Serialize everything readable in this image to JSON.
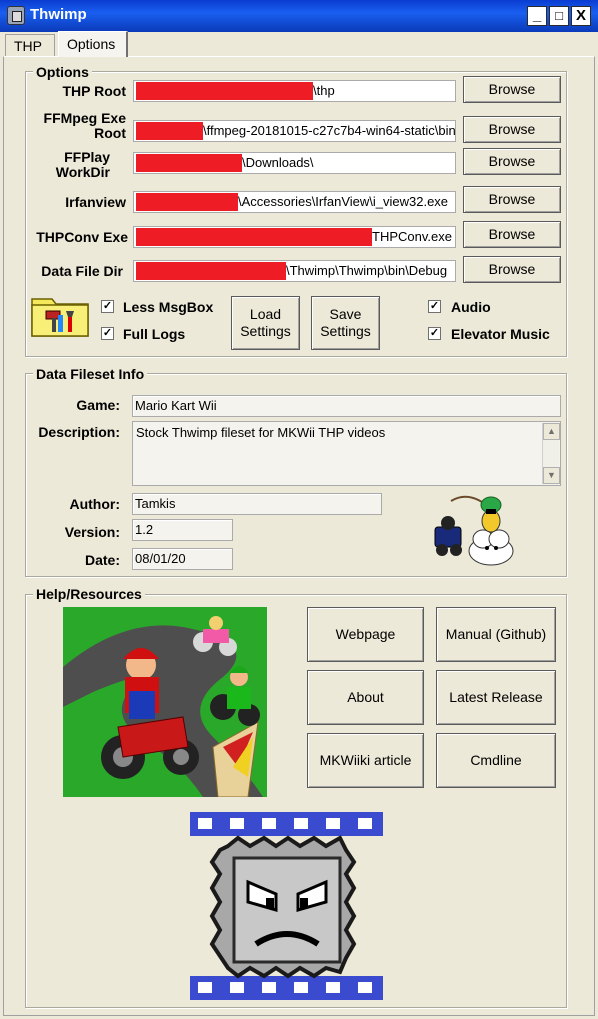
{
  "window": {
    "title": "Thwimp",
    "minimize": "_",
    "maximize": "□",
    "close": "X"
  },
  "tabs": [
    "THP",
    "Options"
  ],
  "options_group": {
    "legend": "Options",
    "rows": [
      {
        "label": "THP Root",
        "path": "\\thp",
        "browse": "Browse"
      },
      {
        "label": "FFMpeg Exe Root",
        "path": "\\ffmpeg-20181015-c27c7b4-win64-static\\bin",
        "browse": "Browse"
      },
      {
        "label": "FFPlay WorkDir",
        "path": "\\Downloads\\",
        "browse": "Browse"
      },
      {
        "label": "Irfanview",
        "path": "\\Accessories\\IrfanView\\i_view32.exe",
        "browse": "Browse"
      },
      {
        "label": "THPConv Exe",
        "path": "THPConv.exe",
        "browse": "Browse"
      },
      {
        "label": "Data File Dir",
        "path": "\\Thwimp\\Thwimp\\bin\\Debug",
        "browse": "Browse"
      }
    ],
    "less_msgbox": "Less MsgBox",
    "full_logs": "Full Logs",
    "load_settings": [
      "Load",
      "Settings"
    ],
    "save_settings": [
      "Save",
      "Settings"
    ],
    "audio": "Audio",
    "elevator_music": "Elevator Music"
  },
  "fileset_group": {
    "legend": "Data Fileset Info",
    "game_label": "Game:",
    "game_value": "Mario Kart Wii",
    "description_label": "Description:",
    "description_value": "Stock Thwimp fileset for MKWii THP videos",
    "author_label": "Author:",
    "author_value": "Tamkis",
    "version_label": "Version:",
    "version_value": "1.2",
    "date_label": "Date:",
    "date_value": "08/01/20"
  },
  "help_group": {
    "legend": "Help/Resources",
    "buttons": [
      "Webpage",
      "Manual (Github)",
      "About",
      "Latest Release",
      "MKWiiki article",
      "Cmdline"
    ]
  },
  "colors": {
    "redaction": "#ee1c25",
    "title_bar": "#0a3cd0",
    "window_bg": "#ece9d8"
  }
}
